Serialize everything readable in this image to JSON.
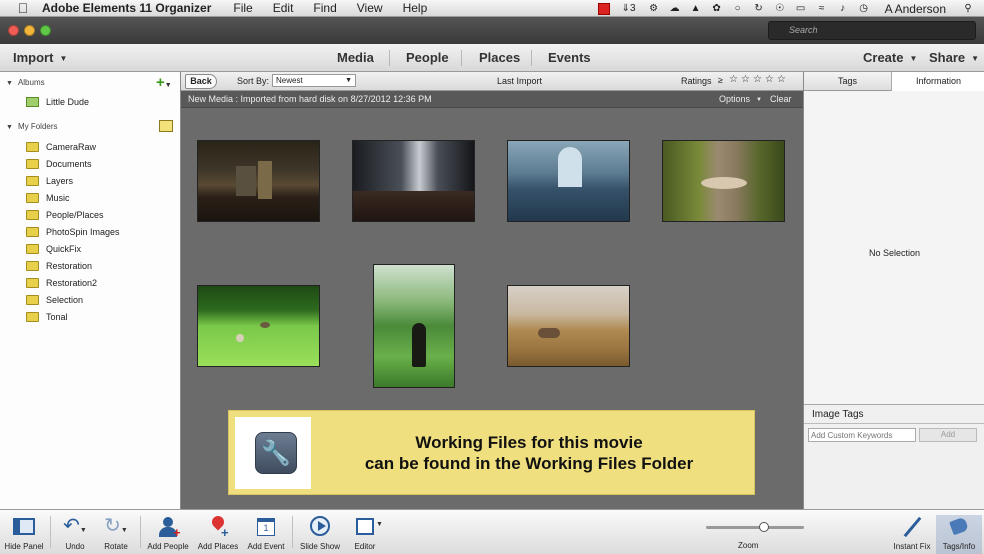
{
  "menubar": {
    "app_name": "Adobe Elements 11 Organizer",
    "items": [
      "File",
      "Edit",
      "Find",
      "View",
      "Help"
    ],
    "badge_count": "3",
    "user": "A Anderson"
  },
  "search": {
    "placeholder": "Search"
  },
  "toolbar": {
    "import_label": "Import",
    "tabs": [
      "Media",
      "People",
      "Places",
      "Events"
    ],
    "create_label": "Create",
    "share_label": "Share"
  },
  "left_panel": {
    "albums_label": "Albums",
    "albums": [
      {
        "label": "Little Dude"
      }
    ],
    "folders_label": "My Folders",
    "folders": [
      {
        "label": "CameraRaw"
      },
      {
        "label": "Documents"
      },
      {
        "label": "Layers"
      },
      {
        "label": "Music"
      },
      {
        "label": "People/Places"
      },
      {
        "label": "PhotoSpin Images"
      },
      {
        "label": "QuickFix"
      },
      {
        "label": "Restoration"
      },
      {
        "label": "Restoration2"
      },
      {
        "label": "Selection"
      },
      {
        "label": "Tonal"
      }
    ]
  },
  "subbar": {
    "back_label": "Back",
    "sort_label": "Sort By:",
    "sort_value": "Newest",
    "view_title": "Last Import",
    "ratings_label": "Ratings",
    "ratings_op": "≥",
    "stars": [
      "☆",
      "☆",
      "☆",
      "☆",
      "☆"
    ]
  },
  "infobar": {
    "text": "New Media : Imported from hard disk on 8/27/2012 12:36 PM",
    "options_label": "Options",
    "clear_label": "Clear"
  },
  "thumbnails": [
    {
      "name": "train-station-interior"
    },
    {
      "name": "train-car-interior"
    },
    {
      "name": "great-hall-interior"
    },
    {
      "name": "tree-fungus"
    },
    {
      "name": "geese-on-lawn"
    },
    {
      "name": "person-in-meadow"
    },
    {
      "name": "deer-in-grass"
    }
  ],
  "banner": {
    "line1": "Working Files for this movie",
    "line2": "can be found in the Working Files Folder",
    "icon": "wrench-icon"
  },
  "right_panel": {
    "tabs": [
      "Tags",
      "Information"
    ],
    "empty_message": "No Selection",
    "image_tags_label": "Image Tags",
    "keywords_placeholder": "Add Custom Keywords",
    "add_label": "Add"
  },
  "bottom_bar": {
    "buttons": [
      "Hide Panel",
      "Undo",
      "Rotate",
      "Add People",
      "Add Places",
      "Add Event",
      "Slide Show",
      "Editor"
    ],
    "zoom_label": "Zoom",
    "zoom_level": 0.6,
    "instant_fix_label": "Instant Fix",
    "tags_info_label": "Tags/Info"
  },
  "colors": {
    "accent_green": "#3a9a1e",
    "banner_yellow": "#efdf7e",
    "content_gray": "#6b6b6b"
  }
}
